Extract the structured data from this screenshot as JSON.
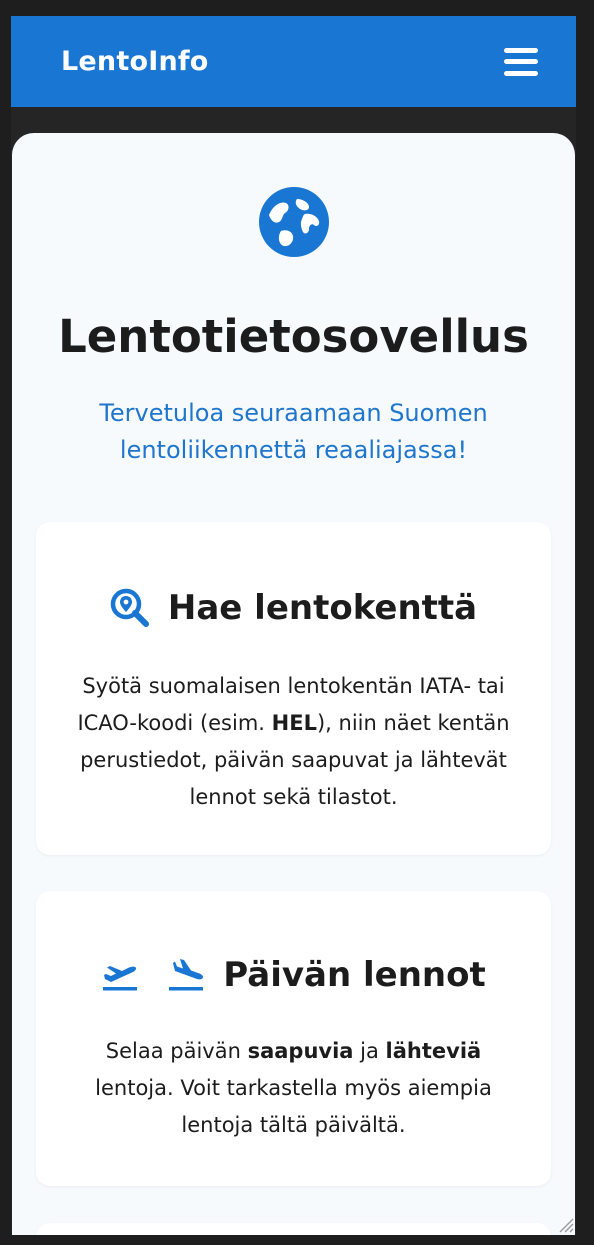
{
  "navbar": {
    "brand": "LentoInfo",
    "menu_icon": "hamburger-menu-icon"
  },
  "hero": {
    "icon": "globe-icon",
    "title": "Lentotietosovellus",
    "subtitle": "Tervetuloa seuraamaan Suomen lentoliikennettä reaaliajassa!"
  },
  "cards": [
    {
      "icon": "search-location-icon",
      "title": "Hae lentokenttä",
      "text_before": "Syötä suomalaisen lentokentän IATA- tai ICAO-koodi (esim. ",
      "text_bold": "HEL",
      "text_after": "), niin näet kentän perustiedot, päivän saapuvat ja lähtevät lennot sekä tilastot."
    },
    {
      "icons": [
        "plane-departure-icon",
        "plane-arrival-icon"
      ],
      "title": "Päivän lennot",
      "text_1": "Selaa päivän ",
      "text_bold_1": "saapuvia",
      "text_2": " ja ",
      "text_bold_2": "lähteviä",
      "text_3": " lentoja. Voit tarkastella myös aiempia lentoja tältä päivältä."
    }
  ],
  "colors": {
    "accent": "#1976d2",
    "accent_text": "#1f76cc",
    "page_bg": "#f6fafd",
    "card_bg": "#ffffff",
    "text": "#1c1c1c"
  }
}
